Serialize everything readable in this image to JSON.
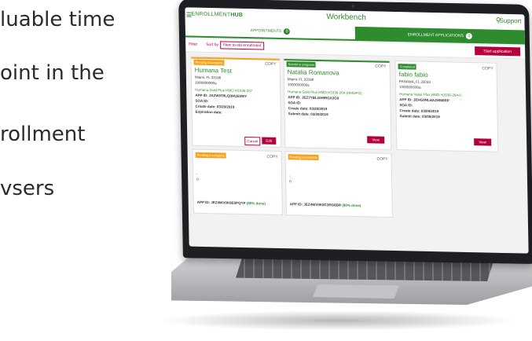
{
  "background_text": [
    "luable time",
    "oint in the",
    "rollment",
    "vsers"
  ],
  "app": {
    "brand_prefix": "ENROLLMENT",
    "brand_suffix": "HUB",
    "title": "Workbench",
    "search_icon": "search-icon",
    "support_label": "Support"
  },
  "tabs": [
    {
      "label": "APPOINTMENTS",
      "count": "0",
      "active": false
    },
    {
      "label": "ENROLLMENT APPLICATIONS",
      "count": "0",
      "active": true
    }
  ],
  "filterbar": {
    "filter_label": "Filter",
    "sort_label": "Sort by",
    "sort_value": "New to old enrollment",
    "start_label": "Start application"
  },
  "cards": [
    {
      "status": "Pending incomplete",
      "copy": "COPY",
      "name": "Humana Test",
      "location": "Miami, FL 33186",
      "phone": "1000000000a",
      "plan": "Humana Gold Plus HMO H1036-237",
      "app_id": "APP ID: JXZW9T9LQ0HUE0WY",
      "soa": "SOA ID:",
      "create": "Create date: 03/20/2019",
      "expire": "Expiration date:",
      "btn1": "Cancel",
      "btn2": "Edit"
    },
    {
      "status": "Submit in progress",
      "copy": "COPY",
      "name": "Natalia Romanova",
      "location": "Miami, FL 33186",
      "phone": "1000000000a",
      "plan": "Humana Gold Plus HMO H1036-204 (HMOPO)",
      "app_id": "APP ID: JEZ7YBLGH9RGX2G9",
      "soa": "SOA ID:",
      "create": "Create date: 03/20/2019",
      "submit": "Submit date: 03/20/2019",
      "btn": "View"
    },
    {
      "status": "Completed",
      "copy": "COPY",
      "name": "fabio fabio",
      "location": "PANAMA, FL 33033",
      "phone": "1000000000a",
      "plan": "Humana Value Plus HMO H1036-264-0",
      "app_id": "APP ID: JEHG9NLHAZHM0RP",
      "soa": "SOA ID:",
      "create": "Create date: 03/09/2019",
      "submit": "Submit date: 03/09/2019",
      "btn": "View"
    },
    {
      "status": "Pending incomplete",
      "copy": "COPY",
      "line1": "-",
      "line2": "0",
      "app_id": "APP ID: JEZ4WV0K8E0PQYP",
      "progress": "(80% done)"
    },
    {
      "status": "Pending incomplete",
      "copy": "COPY",
      "line1": "-",
      "line2": "0",
      "app_id": "APP ID: JEZ4WV0K8C3RG6BR",
      "progress": "(80% done)"
    }
  ]
}
